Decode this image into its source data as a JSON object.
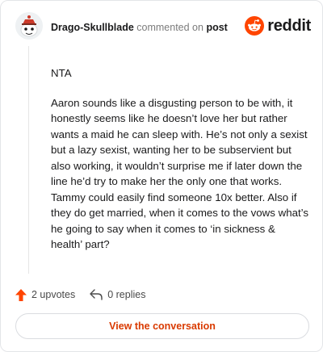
{
  "header": {
    "username": "Drago-Skullblade",
    "action_text": "commented on",
    "target_text": "post",
    "brand": "reddit"
  },
  "comment": {
    "paragraphs": [
      "NTA",
      "Aaron sounds like a disgusting person to be with, it honestly seems like he doesn’t love her but rather wants a maid he can sleep with. He’s not only a sexist but a lazy sexist, wanting her to be subservient but also working, it wouldn’t surprise me if later down the line he’d try to make her the only one that works. Tammy could easily find someone 10x better. Also if they do get married, when it comes to the vows what’s he going to say when it comes to ‘in sickness & health’ part?"
    ]
  },
  "actions": {
    "upvotes": "2 upvotes",
    "replies": "0 replies"
  },
  "cta": {
    "label": "View the conversation"
  },
  "colors": {
    "brand_orange": "#ff4500",
    "cta_text": "#d93a00"
  },
  "icons": [
    "snoo-avatar-icon",
    "reddit-logo-icon",
    "upvote-arrow-icon",
    "reply-arrow-icon"
  ]
}
